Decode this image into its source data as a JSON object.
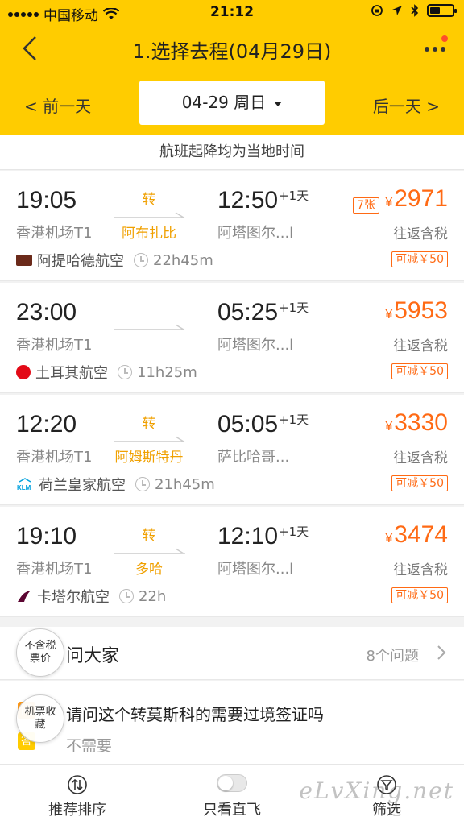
{
  "status_bar": {
    "carrier": "中国移动",
    "time": "21:12"
  },
  "nav": {
    "title": "1.选择去程(04月29日)"
  },
  "date_bar": {
    "prev": "< 前一天",
    "current": "04-29 周日",
    "next": "后一天 >"
  },
  "notice": "航班起降均为当地时间",
  "flights": [
    {
      "dep_time": "19:05",
      "dep_airport": "香港机场T1",
      "transfer_word": "转",
      "transfer_city": "阿布扎比",
      "arr_time": "12:50",
      "plus_day": "+1天",
      "arr_airport": "阿塔图尔...l",
      "airline": "阿提哈德航空",
      "duration": "22h45m",
      "seats": "7张",
      "currency": "¥",
      "price": "2971",
      "tax_note": "往返含税",
      "discount": "可减￥50",
      "logo_color": "#6b2a1a"
    },
    {
      "dep_time": "23:00",
      "dep_airport": "香港机场T1",
      "transfer_word": "",
      "transfer_city": "",
      "arr_time": "05:25",
      "plus_day": "+1天",
      "arr_airport": "阿塔图尔...l",
      "airline": "土耳其航空",
      "duration": "11h25m",
      "seats": "",
      "currency": "¥",
      "price": "5953",
      "tax_note": "往返含税",
      "discount": "可减￥50",
      "logo_color": "#e30a17"
    },
    {
      "dep_time": "12:20",
      "dep_airport": "香港机场T1",
      "transfer_word": "转",
      "transfer_city": "阿姆斯特丹",
      "arr_time": "05:05",
      "plus_day": "+1天",
      "arr_airport": "萨比哈哥...",
      "airline": "荷兰皇家航空",
      "duration": "21h45m",
      "seats": "",
      "currency": "¥",
      "price": "3330",
      "tax_note": "往返含税",
      "discount": "可减￥50",
      "logo_color": "#00a1de"
    },
    {
      "dep_time": "19:10",
      "dep_airport": "香港机场T1",
      "transfer_word": "转",
      "transfer_city": "多哈",
      "arr_time": "12:10",
      "plus_day": "+1天",
      "arr_airport": "阿塔图尔...l",
      "airline": "卡塔尔航空",
      "duration": "22h",
      "seats": "",
      "currency": "¥",
      "price": "3474",
      "tax_note": "往返含税",
      "discount": "可减￥50",
      "logo_color": "#5c0632"
    }
  ],
  "ask": {
    "title": "问大家",
    "count": "8个问题",
    "question_icon": "问",
    "answer_icon": "答",
    "question": "请问这个转莫斯科的需要过境签证吗",
    "answer": "不需要"
  },
  "floating": {
    "tax_toggle": "不含税票价",
    "favorite": "机票收藏"
  },
  "tabbar": {
    "sort": "推荐排序",
    "direct": "只看直飞",
    "filter": "筛选"
  },
  "watermark": "eLvXing.net"
}
